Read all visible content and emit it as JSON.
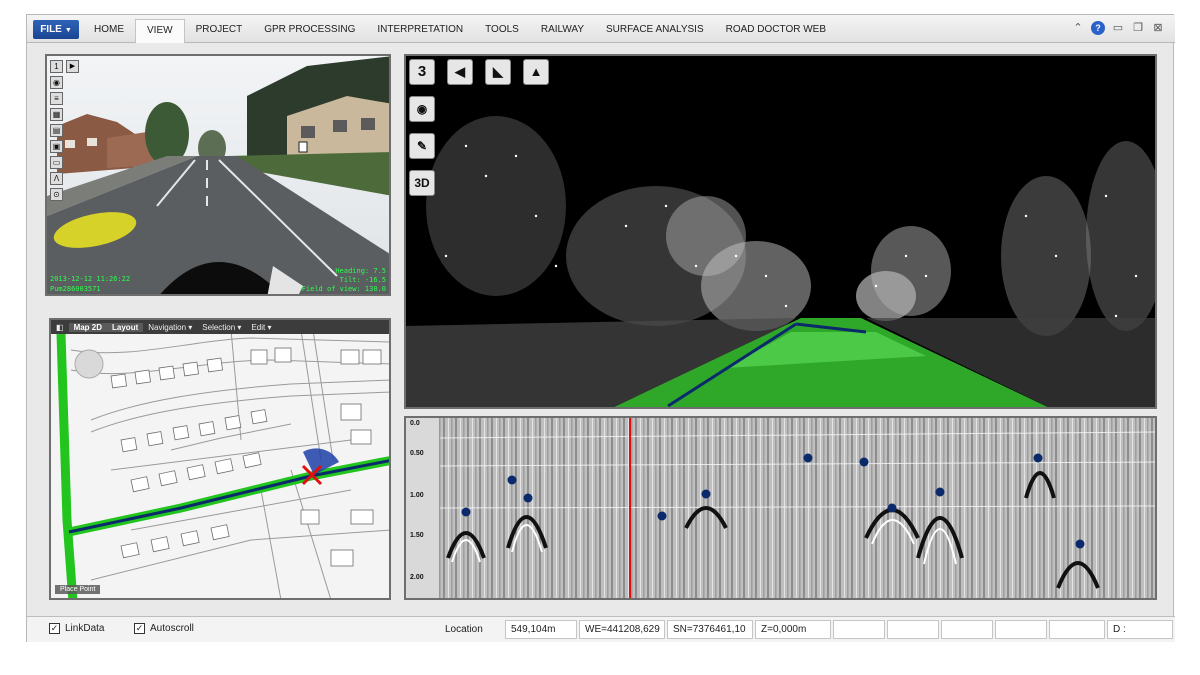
{
  "ribbon": {
    "file_label": "FILE",
    "tabs": [
      {
        "label": "HOME"
      },
      {
        "label": "VIEW"
      },
      {
        "label": "PROJECT"
      },
      {
        "label": "GPR PROCESSING"
      },
      {
        "label": "INTERPRETATION"
      },
      {
        "label": "TOOLS"
      },
      {
        "label": "RAILWAY"
      },
      {
        "label": "SURFACE ANALYSIS"
      },
      {
        "label": "ROAD DOCTOR WEB"
      }
    ],
    "active_tab": "VIEW"
  },
  "photo": {
    "timestamp": "2013-12-12 11:26:22",
    "frame_id": "Pum286003571",
    "heading": "Heading:  7.5",
    "tilt": "Tilt: -16.5",
    "fov": "Field of view: 130.0",
    "frame_number": "1"
  },
  "map": {
    "tabs": [
      "Map 2D",
      "Layout",
      "Navigation ▾",
      "Selection ▾",
      "Edit ▾"
    ],
    "place_point": "Place Point"
  },
  "cloud": {
    "tool_3": "3",
    "tool_3d": "3D"
  },
  "gpr": {
    "depth_ticks": [
      "0.0",
      "0.50",
      "1.00",
      "1.50",
      "2.00"
    ]
  },
  "status": {
    "linkdata": "LinkData",
    "autoscroll": "Autoscroll",
    "location_label": "Location",
    "location_value": "549,104m",
    "we": "WE=441208,629",
    "sn": "SN=7376461,10",
    "z": "Z=0,000m",
    "d": "D :"
  },
  "colors": {
    "file_button": "#1b4593",
    "road_highlight": "#22c41e",
    "track_line": "#0b2a6b",
    "cursor_line": "#e01010",
    "overlay_text": "#2bff4a"
  }
}
